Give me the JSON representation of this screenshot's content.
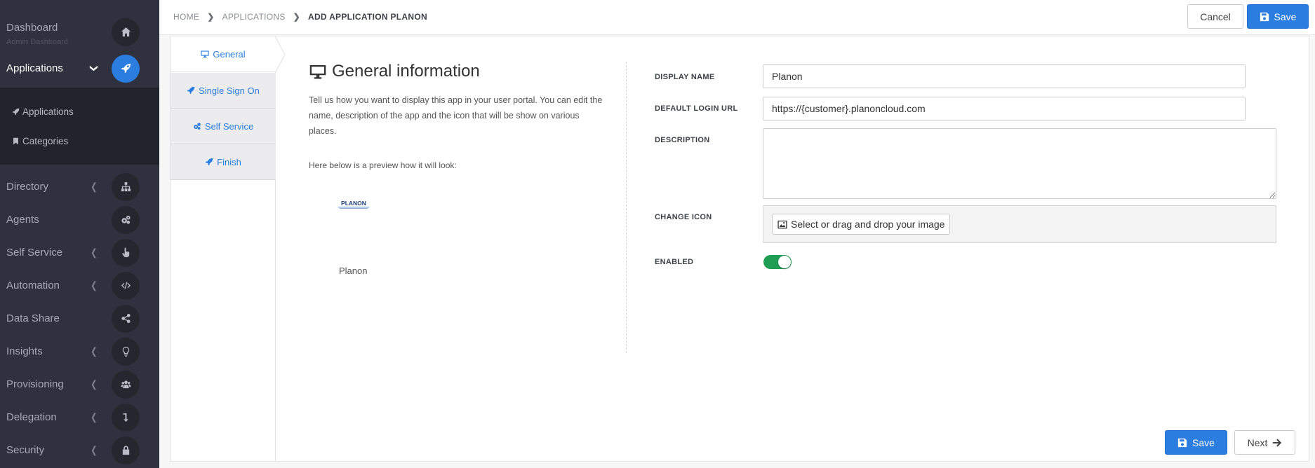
{
  "sidebar": {
    "dashboard": {
      "label": "Dashboard",
      "sub": "Admin Dashboard",
      "icon": "home-icon"
    },
    "applications": {
      "label": "Applications",
      "icon": "rocket-icon"
    },
    "sub_items": [
      {
        "label": "Applications",
        "icon": "rocket-icon"
      },
      {
        "label": "Categories",
        "icon": "bookmark-icon"
      }
    ],
    "items": [
      {
        "label": "Directory",
        "icon": "sitemap-icon"
      },
      {
        "label": "Agents",
        "icon": "cogs-icon"
      },
      {
        "label": "Self Service",
        "icon": "hand-pointer-icon"
      },
      {
        "label": "Automation",
        "icon": "code-icon"
      },
      {
        "label": "Data Share",
        "icon": "share-icon"
      },
      {
        "label": "Insights",
        "icon": "lightbulb-icon"
      },
      {
        "label": "Provisioning",
        "icon": "users-icon"
      },
      {
        "label": "Delegation",
        "icon": "level-down-icon"
      },
      {
        "label": "Security",
        "icon": "lock-icon"
      }
    ]
  },
  "breadcrumb": {
    "home": "HOME",
    "applications": "APPLICATIONS",
    "current": "ADD APPLICATION PLANON"
  },
  "toolbar": {
    "cancel_label": "Cancel",
    "save_label": "Save"
  },
  "tabs": [
    {
      "label": "General",
      "icon": "desktop-icon",
      "active": true
    },
    {
      "label": "Single Sign On",
      "icon": "rocket-icon"
    },
    {
      "label": "Self Service",
      "icon": "cogs-icon"
    },
    {
      "label": "Finish",
      "icon": "rocket-icon"
    }
  ],
  "info": {
    "title": "General information",
    "description": "Tell us how you want to display this app in your user portal. You can edit the name, description of the app and the icon that will be show on various places.",
    "preview_label": "Here below is a preview how it will look:",
    "preview_logo_text": "PLANON",
    "preview_name": "Planon"
  },
  "form": {
    "display_name": {
      "label": "DISPLAY NAME",
      "value": "Planon"
    },
    "default_login_url": {
      "label": "DEFAULT LOGIN URL",
      "value": "https://{customer}.planoncloud.com"
    },
    "description": {
      "label": "DESCRIPTION",
      "value": ""
    },
    "change_icon": {
      "label": "CHANGE ICON",
      "button_label": "Select or drag and drop your image"
    },
    "enabled": {
      "label": "ENABLED",
      "value": true
    }
  },
  "footer": {
    "save_label": "Save",
    "next_label": "Next"
  },
  "colors": {
    "accent": "#2b7de0",
    "sidebar_bg": "#2f323e",
    "toggle_on": "#1f9d55"
  }
}
